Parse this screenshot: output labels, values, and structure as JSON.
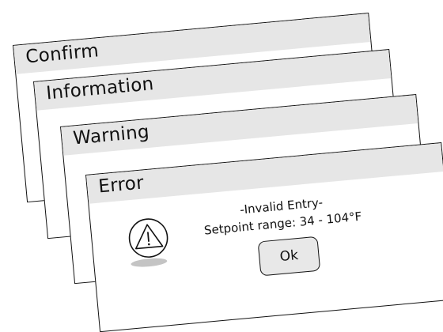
{
  "dialogs": {
    "confirm": {
      "title": "Confirm"
    },
    "information": {
      "title": "Information"
    },
    "warning": {
      "title": "Warning"
    },
    "error": {
      "title": "Error",
      "message_line1": "-Invalid Entry-",
      "message_line2": "Setpoint range: 34 - 104°F",
      "ok_label": "Ok",
      "icon": "warning-triangle-icon"
    }
  },
  "colors": {
    "title_bar": "#e6e6e6",
    "outline": "#111111",
    "icon_shadow": "#c4c4c4",
    "button_fill": "#e8e8e8"
  }
}
